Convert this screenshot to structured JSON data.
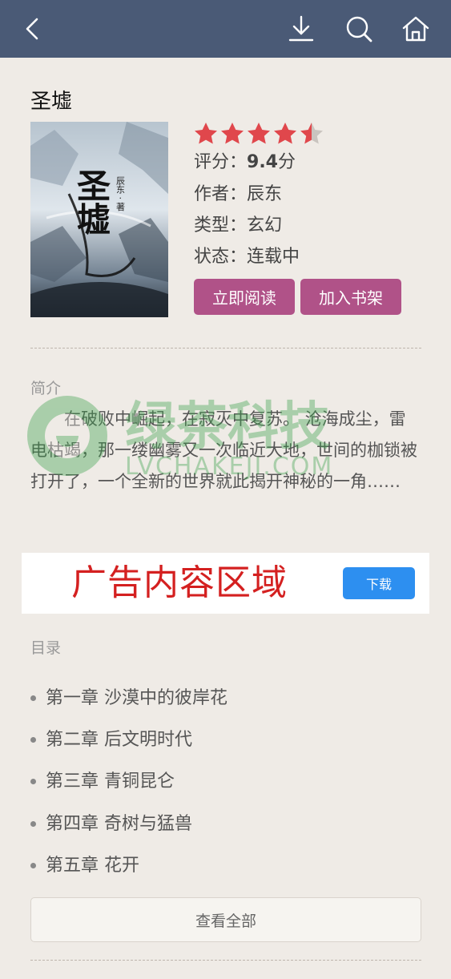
{
  "header": {
    "icons": [
      "back-icon",
      "download-icon",
      "search-icon",
      "home-icon"
    ],
    "background": "#4a5a76"
  },
  "book": {
    "title": "圣墟",
    "cover_title": "圣墟",
    "cover_author": "辰东 · 著",
    "rating_stars": 4.5,
    "rating_label": "评分：",
    "rating_value": "9.4",
    "rating_unit": "分",
    "author_line": "作者：辰东",
    "genre_line": "类型：玄幻",
    "status_line": "状态：连载中"
  },
  "actions": {
    "read_label": "立即阅读",
    "shelf_label": "加入书架"
  },
  "intro": {
    "label": "简介",
    "text": "在破败中崛起，在寂灭中复苏。 沧海成尘，雷电枯竭，那一缕幽雾又一次临近大地，世间的枷锁被打开了，一个全新的世界就此揭开神秘的一角……"
  },
  "watermark": {
    "text": "绿茶科技",
    "sub": "LVCHAKEJI.COM"
  },
  "ad": {
    "text": "广告内容区域",
    "button_label": "下载"
  },
  "toc": {
    "label": "目录",
    "chapters": [
      "第一章 沙漠中的彼岸花",
      "第二章 后文明时代",
      "第三章 青铜昆仑",
      "第四章 奇树与猛兽",
      "第五章 花开"
    ],
    "view_all_label": "查看全部"
  },
  "colors": {
    "accent": "#b05288",
    "star": "#e0474c",
    "ad_button": "#2d8ff0",
    "ad_text": "#d42020"
  }
}
